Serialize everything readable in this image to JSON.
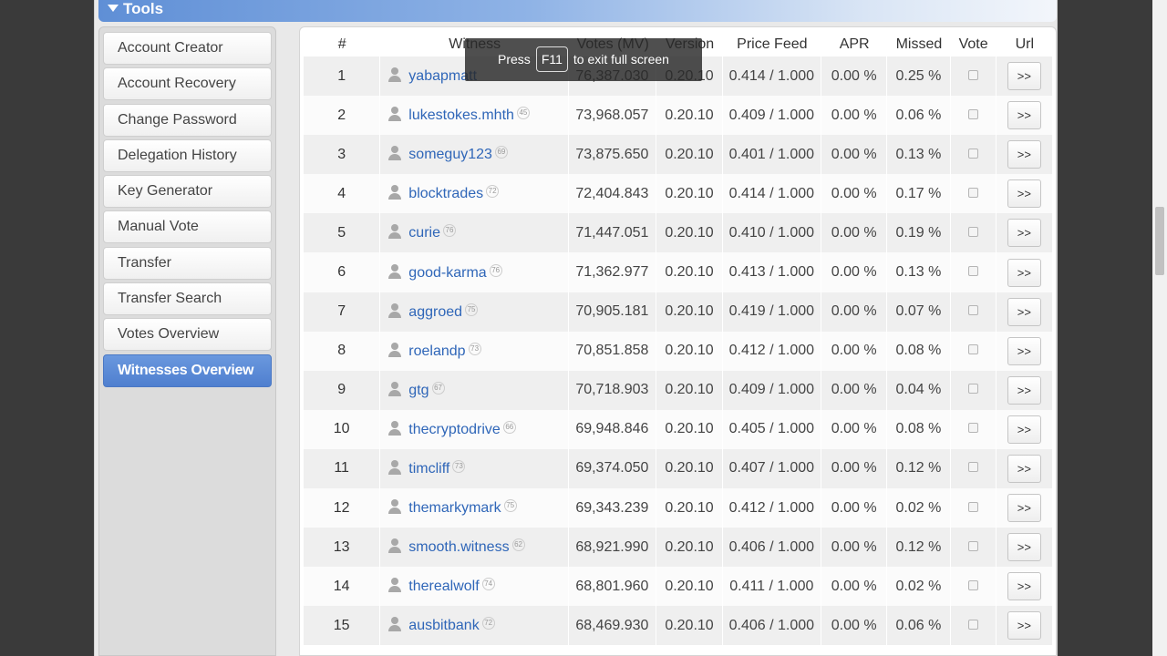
{
  "tools_header": "Tools",
  "sidebar": [
    {
      "label": "Account Creator",
      "active": false
    },
    {
      "label": "Account Recovery",
      "active": false
    },
    {
      "label": "Change Password",
      "active": false
    },
    {
      "label": "Delegation History",
      "active": false
    },
    {
      "label": "Key Generator",
      "active": false
    },
    {
      "label": "Manual Vote",
      "active": false
    },
    {
      "label": "Transfer",
      "active": false
    },
    {
      "label": "Transfer Search",
      "active": false
    },
    {
      "label": "Votes Overview",
      "active": false
    },
    {
      "label": "Witnesses Overview",
      "active": true
    }
  ],
  "table": {
    "headers": [
      "#",
      "Witness",
      "Votes (MV)",
      "Version",
      "Price Feed",
      "APR",
      "Missed",
      "Vote",
      "Url"
    ],
    "url_button": ">>",
    "rows": [
      {
        "rank": "1",
        "name": "yabapmatt",
        "rep": "",
        "votes": "76,387.030",
        "version": "0.20.10",
        "price_feed": "0.414 / 1.000",
        "apr": "0.00 %",
        "missed": "0.25 %"
      },
      {
        "rank": "2",
        "name": "lukestokes.mhth",
        "rep": "45",
        "votes": "73,968.057",
        "version": "0.20.10",
        "price_feed": "0.409 / 1.000",
        "apr": "0.00 %",
        "missed": "0.06 %"
      },
      {
        "rank": "3",
        "name": "someguy123",
        "rep": "69",
        "votes": "73,875.650",
        "version": "0.20.10",
        "price_feed": "0.401 / 1.000",
        "apr": "0.00 %",
        "missed": "0.13 %"
      },
      {
        "rank": "4",
        "name": "blocktrades",
        "rep": "72",
        "votes": "72,404.843",
        "version": "0.20.10",
        "price_feed": "0.414 / 1.000",
        "apr": "0.00 %",
        "missed": "0.17 %"
      },
      {
        "rank": "5",
        "name": "curie",
        "rep": "76",
        "votes": "71,447.051",
        "version": "0.20.10",
        "price_feed": "0.410 / 1.000",
        "apr": "0.00 %",
        "missed": "0.19 %"
      },
      {
        "rank": "6",
        "name": "good-karma",
        "rep": "76",
        "votes": "71,362.977",
        "version": "0.20.10",
        "price_feed": "0.413 / 1.000",
        "apr": "0.00 %",
        "missed": "0.13 %"
      },
      {
        "rank": "7",
        "name": "aggroed",
        "rep": "75",
        "votes": "70,905.181",
        "version": "0.20.10",
        "price_feed": "0.419 / 1.000",
        "apr": "0.00 %",
        "missed": "0.07 %"
      },
      {
        "rank": "8",
        "name": "roelandp",
        "rep": "73",
        "votes": "70,851.858",
        "version": "0.20.10",
        "price_feed": "0.412 / 1.000",
        "apr": "0.00 %",
        "missed": "0.08 %"
      },
      {
        "rank": "9",
        "name": "gtg",
        "rep": "67",
        "votes": "70,718.903",
        "version": "0.20.10",
        "price_feed": "0.409 / 1.000",
        "apr": "0.00 %",
        "missed": "0.04 %"
      },
      {
        "rank": "10",
        "name": "thecryptodrive",
        "rep": "66",
        "votes": "69,948.846",
        "version": "0.20.10",
        "price_feed": "0.405 / 1.000",
        "apr": "0.00 %",
        "missed": "0.08 %"
      },
      {
        "rank": "11",
        "name": "timcliff",
        "rep": "73",
        "votes": "69,374.050",
        "version": "0.20.10",
        "price_feed": "0.407 / 1.000",
        "apr": "0.00 %",
        "missed": "0.12 %"
      },
      {
        "rank": "12",
        "name": "themarkymark",
        "rep": "75",
        "votes": "69,343.239",
        "version": "0.20.10",
        "price_feed": "0.412 / 1.000",
        "apr": "0.00 %",
        "missed": "0.02 %"
      },
      {
        "rank": "13",
        "name": "smooth.witness",
        "rep": "62",
        "votes": "68,921.990",
        "version": "0.20.10",
        "price_feed": "0.406 / 1.000",
        "apr": "0.00 %",
        "missed": "0.12 %"
      },
      {
        "rank": "14",
        "name": "therealwolf",
        "rep": "74",
        "votes": "68,801.960",
        "version": "0.20.10",
        "price_feed": "0.411 / 1.000",
        "apr": "0.00 %",
        "missed": "0.02 %"
      },
      {
        "rank": "15",
        "name": "ausbitbank",
        "rep": "72",
        "votes": "68,469.930",
        "version": "0.20.10",
        "price_feed": "0.406 / 1.000",
        "apr": "0.00 %",
        "missed": "0.06 %"
      }
    ]
  },
  "fullscreen_toast": {
    "before": "Press",
    "key": "F11",
    "after": "to exit full screen"
  }
}
